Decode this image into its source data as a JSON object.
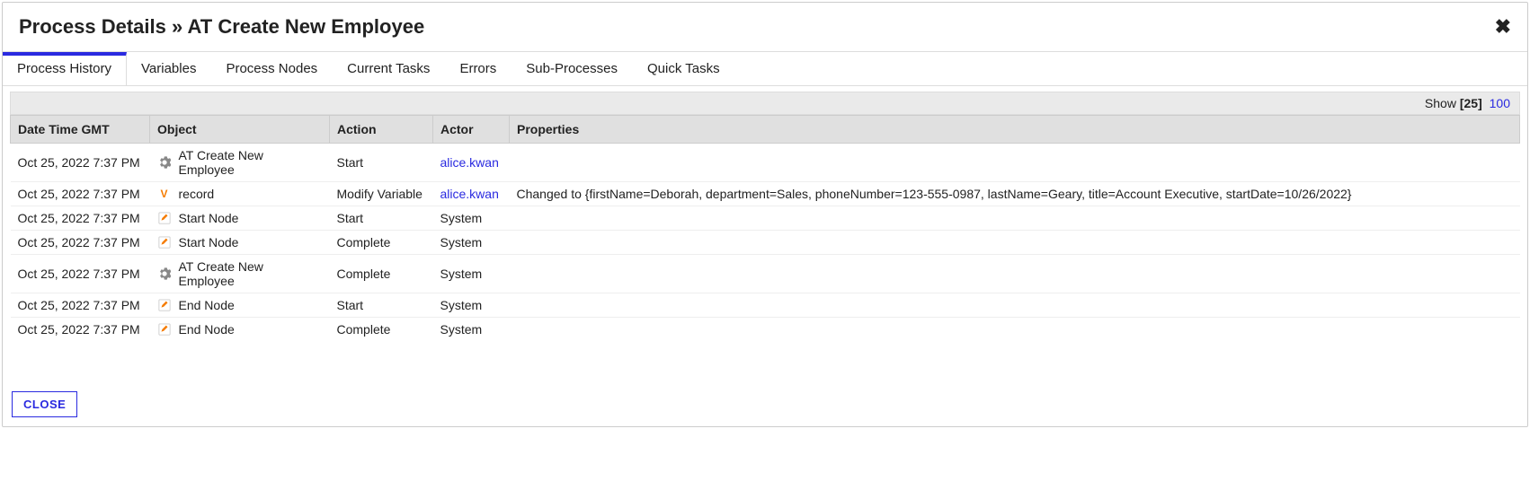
{
  "header": {
    "title_prefix": "Process Details » ",
    "title_name": "AT Create New Employee"
  },
  "tabs": [
    {
      "label": "Process History",
      "active": true
    },
    {
      "label": "Variables",
      "active": false
    },
    {
      "label": "Process Nodes",
      "active": false
    },
    {
      "label": "Current Tasks",
      "active": false
    },
    {
      "label": "Errors",
      "active": false
    },
    {
      "label": "Sub-Processes",
      "active": false
    },
    {
      "label": "Quick Tasks",
      "active": false
    }
  ],
  "pager": {
    "show_label": "Show ",
    "current": "[25]",
    "option": "100"
  },
  "columns": {
    "datetime": "Date Time GMT",
    "object": "Object",
    "action": "Action",
    "actor": "Actor",
    "properties": "Properties"
  },
  "rows": [
    {
      "datetime": "Oct 25, 2022 7:37 PM",
      "icon": "gear",
      "object": "AT Create New Employee",
      "action": "Start",
      "actor": "alice.kwan",
      "actor_link": true,
      "properties": ""
    },
    {
      "datetime": "Oct 25, 2022 7:37 PM",
      "icon": "v",
      "object": "record",
      "action": "Modify Variable",
      "actor": "alice.kwan",
      "actor_link": true,
      "properties": "Changed to {firstName=Deborah, department=Sales, phoneNumber=123-555-0987, lastName=Geary, title=Account Executive, startDate=10/26/2022}"
    },
    {
      "datetime": "Oct 25, 2022 7:37 PM",
      "icon": "edit",
      "object": "Start Node",
      "action": "Start",
      "actor": "System",
      "actor_link": false,
      "properties": ""
    },
    {
      "datetime": "Oct 25, 2022 7:37 PM",
      "icon": "edit",
      "object": "Start Node",
      "action": "Complete",
      "actor": "System",
      "actor_link": false,
      "properties": ""
    },
    {
      "datetime": "Oct 25, 2022 7:37 PM",
      "icon": "gear",
      "object": "AT Create New Employee",
      "action": "Complete",
      "actor": "System",
      "actor_link": false,
      "properties": ""
    },
    {
      "datetime": "Oct 25, 2022 7:37 PM",
      "icon": "edit",
      "object": "End Node",
      "action": "Start",
      "actor": "System",
      "actor_link": false,
      "properties": ""
    },
    {
      "datetime": "Oct 25, 2022 7:37 PM",
      "icon": "edit",
      "object": "End Node",
      "action": "Complete",
      "actor": "System",
      "actor_link": false,
      "properties": ""
    }
  ],
  "footer": {
    "close_label": "CLOSE"
  }
}
